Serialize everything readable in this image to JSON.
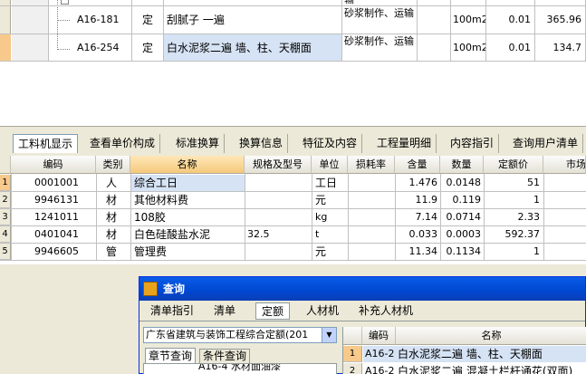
{
  "top_rows": [
    {
      "code": "A16-181",
      "type": "定",
      "name": "刮腻子 一遍",
      "work": "砂浆制作、运输",
      "unit": "100m2",
      "qty": "0.01",
      "price": "365.96"
    },
    {
      "code": "A16-254",
      "type": "定",
      "name": "白水泥浆二遍 墙、柱、天棚面",
      "work": "砂浆制作、运输",
      "unit": "100m2",
      "qty": "0.01",
      "price": "134.7"
    }
  ],
  "top_partial": "输",
  "tabs": [
    "工料机显示",
    "查看单价构成",
    "标准换算",
    "换算信息",
    "特征及内容",
    "工程量明细",
    "内容指引",
    "查询用户清单"
  ],
  "res_headers": [
    "编码",
    "类别",
    "名称",
    "规格及型号",
    "单位",
    "损耗率",
    "含量",
    "数量",
    "定额价",
    "市场"
  ],
  "res_rows": [
    {
      "num": "1",
      "code": "0001001",
      "cat": "人",
      "name": "综合工日",
      "spec": "",
      "unit": "工日",
      "loss": "",
      "content": "1.476",
      "qty": "0.0148",
      "price": "51"
    },
    {
      "num": "2",
      "code": "9946131",
      "cat": "材",
      "name": "其他材料费",
      "spec": "",
      "unit": "元",
      "loss": "",
      "content": "11.9",
      "qty": "0.119",
      "price": "1"
    },
    {
      "num": "3",
      "code": "1241011",
      "cat": "材",
      "name": "108胶",
      "spec": "",
      "unit": "kg",
      "loss": "",
      "content": "7.14",
      "qty": "0.0714",
      "price": "2.33"
    },
    {
      "num": "4",
      "code": "0401041",
      "cat": "材",
      "name": "白色硅酸盐水泥",
      "spec": "32.5",
      "unit": "t",
      "loss": "",
      "content": "0.033",
      "qty": "0.0003",
      "price": "592.37"
    },
    {
      "num": "5",
      "code": "9946605",
      "cat": "管",
      "name": "管理费",
      "spec": "",
      "unit": "元",
      "loss": "",
      "content": "11.34",
      "qty": "0.1134",
      "price": "1"
    }
  ],
  "dialog": {
    "title": "查询",
    "tabs": [
      "清单指引",
      "清单",
      "定额",
      "人材机",
      "补充人材机"
    ],
    "library": "广东省建筑与装饰工程综合定额(201",
    "subtabs": [
      "章节查询",
      "条件查询"
    ],
    "tree_partial": "A16-4 水材面油漆",
    "header_code": "编码",
    "header_name": "名称",
    "rows": [
      {
        "num": "1",
        "code": "A16-2",
        "name": "白水泥浆二遍 墙、柱、天棚面"
      },
      {
        "num": "2",
        "code": "A16-2",
        "name": "白水泥浆二遍 混凝土栏杆通花(双面)"
      }
    ]
  },
  "colors": {
    "accent": "#0a5ce7",
    "selected": "#f5c97b",
    "title_text": "#ffffff"
  }
}
